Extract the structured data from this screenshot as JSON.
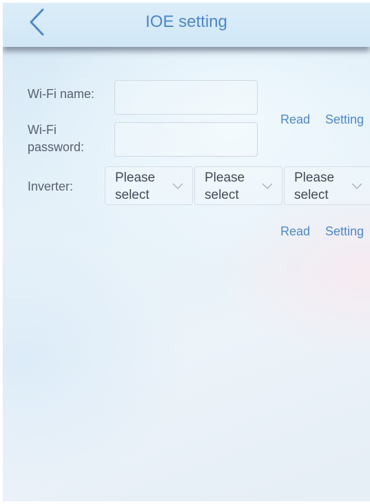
{
  "header": {
    "title": "IOE setting",
    "back_icon": "chevron-left-icon"
  },
  "wifi": {
    "name_label": "Wi-Fi name:",
    "name_value": "",
    "password_label_line1": "Wi-Fi",
    "password_label_line2": "password:",
    "password_value": "",
    "read_label": "Read",
    "setting_label": "Setting"
  },
  "inverter": {
    "label": "Inverter:",
    "selects": [
      {
        "line1": "Please",
        "line2": "select"
      },
      {
        "line1": "Please",
        "line2": "select"
      },
      {
        "line1": "Please",
        "line2": "select"
      }
    ],
    "read_label": "Read",
    "setting_label": "Setting"
  },
  "colors": {
    "accent": "#4d87c6",
    "label_text": "#5a6070",
    "header_background": "#d4e9f7"
  }
}
